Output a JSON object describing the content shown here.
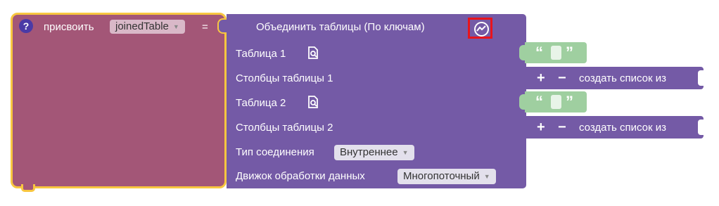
{
  "assign": {
    "help": "?",
    "label": "присвоить",
    "variable": "joinedTable",
    "equals": "="
  },
  "join": {
    "title": "Объединить таблицы (По ключам)",
    "rows": {
      "table1": "Таблица 1",
      "cols1": "Столбцы таблицы 1",
      "table2": "Таблица 2",
      "cols2": "Столбцы таблицы 2",
      "join_type_label": "Тип соединения",
      "join_type_value": "Внутреннее",
      "engine_label": "Движок обработки данных",
      "engine_value": "Многопоточный"
    }
  },
  "text_blocks": {
    "open_quote": "“",
    "close_quote": "”"
  },
  "list_blocks": {
    "plus": "+",
    "minus": "−",
    "label": "создать список из"
  },
  "colors": {
    "assign_block": "#a35677",
    "join_block": "#745aa6",
    "text_block": "#9fcfa0",
    "selection_border": "#f8c640",
    "highlight": "#e8141c"
  }
}
